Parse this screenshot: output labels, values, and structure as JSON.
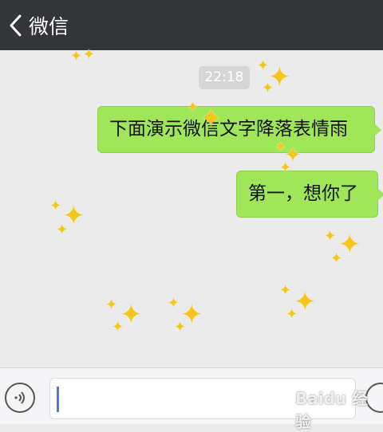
{
  "header": {
    "back_label": "微信",
    "back_icon": "chevron-left-icon"
  },
  "chat": {
    "timestamp": "22:18",
    "messages": [
      {
        "text": "下面演示微信文字降落表情雨",
        "sender": "self"
      },
      {
        "text": "第一，想你了",
        "sender": "self"
      }
    ]
  },
  "composer": {
    "voice_icon": "voice-icon",
    "emoji_icon": "emoji-icon",
    "input_value": ""
  },
  "watermark": {
    "text": "Baidu 经验"
  },
  "colors": {
    "bubble": "#9fe658",
    "header": "#333538",
    "background": "#ebebeb",
    "sparkle": "#f5c61d"
  }
}
